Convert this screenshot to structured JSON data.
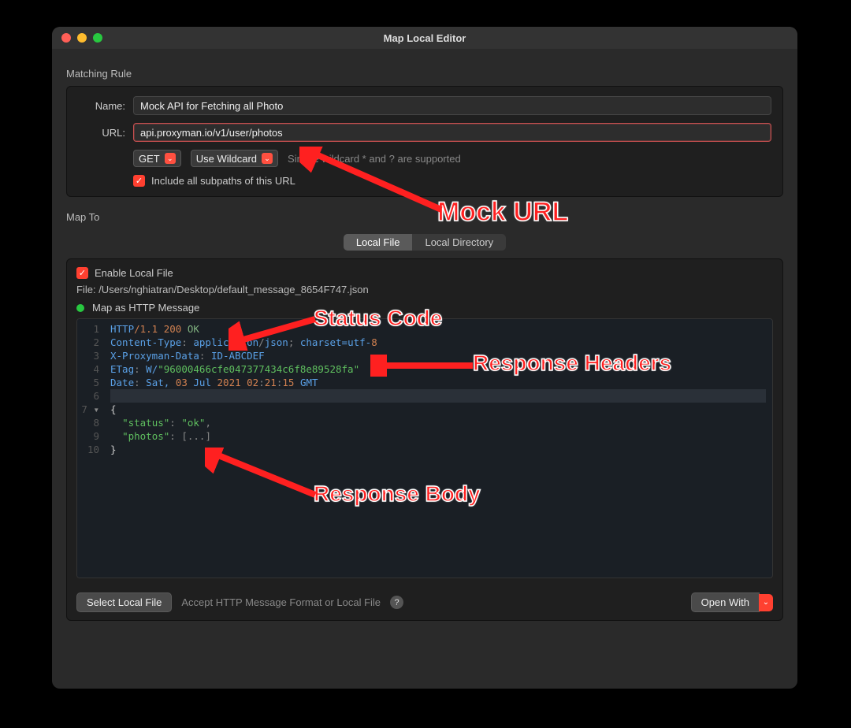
{
  "window": {
    "title": "Map Local Editor"
  },
  "matching": {
    "section_label": "Matching Rule",
    "name_label": "Name:",
    "name_value": "Mock API for Fetching all Photo",
    "url_label": "URL:",
    "url_value": "api.proxyman.io/v1/user/photos",
    "method": "GET",
    "wildcard_label": "Use Wildcard",
    "wildcard_hint": "Simple wildcard * and ? are supported",
    "include_subpath_label": "Include all subpaths of this URL",
    "include_subpath_checked": true
  },
  "mapto": {
    "section_label": "Map To",
    "tabs": {
      "local_file": "Local File",
      "local_dir": "Local Directory",
      "active": "local_file"
    },
    "enable_label": "Enable Local File",
    "enable_checked": true,
    "file_label": "File:",
    "file_path": "/Users/nghiatran/Desktop/default_message_8654F747.json",
    "map_http_label": "Map as HTTP Message"
  },
  "editor": {
    "lines": [
      "1",
      "2",
      "3",
      "4",
      "5",
      "6",
      "7",
      "8",
      "9",
      "10"
    ],
    "http": {
      "proto": "HTTP",
      "ver": "/1.1",
      "code": "200",
      "status": "OK"
    },
    "headers": {
      "ct_key": "Content-Type",
      "ct_val1": "application",
      "ct_val2": "json",
      "ct_charset": "charset=utf-",
      "ct_charsetv": "8",
      "xp_key": "X-Proxyman-Data",
      "xp_val": "ID-ABCDEF",
      "etag_key": "ETag",
      "etag_pre": "W/",
      "etag_val": "\"96000466cfe047377434c6f8e89528fa\"",
      "date_key": "Date",
      "date_txt1": "Sat,",
      "date_day": "03",
      "date_mon": "Jul",
      "date_year": "2021",
      "date_h": "02",
      "date_m": "21",
      "date_s": "15",
      "date_tz": "GMT"
    },
    "body": {
      "status_key": "\"status\"",
      "status_val": "\"ok\"",
      "photos_key": "\"photos\"",
      "photos_val": "[...]"
    }
  },
  "footer": {
    "select_file": "Select Local File",
    "hint": "Accept HTTP Message Format or Local File",
    "open_with": "Open With"
  },
  "annotations": {
    "mock_url": "Mock URL",
    "status_code": "Status Code",
    "resp_headers": "Response Headers",
    "resp_body": "Response Body"
  }
}
